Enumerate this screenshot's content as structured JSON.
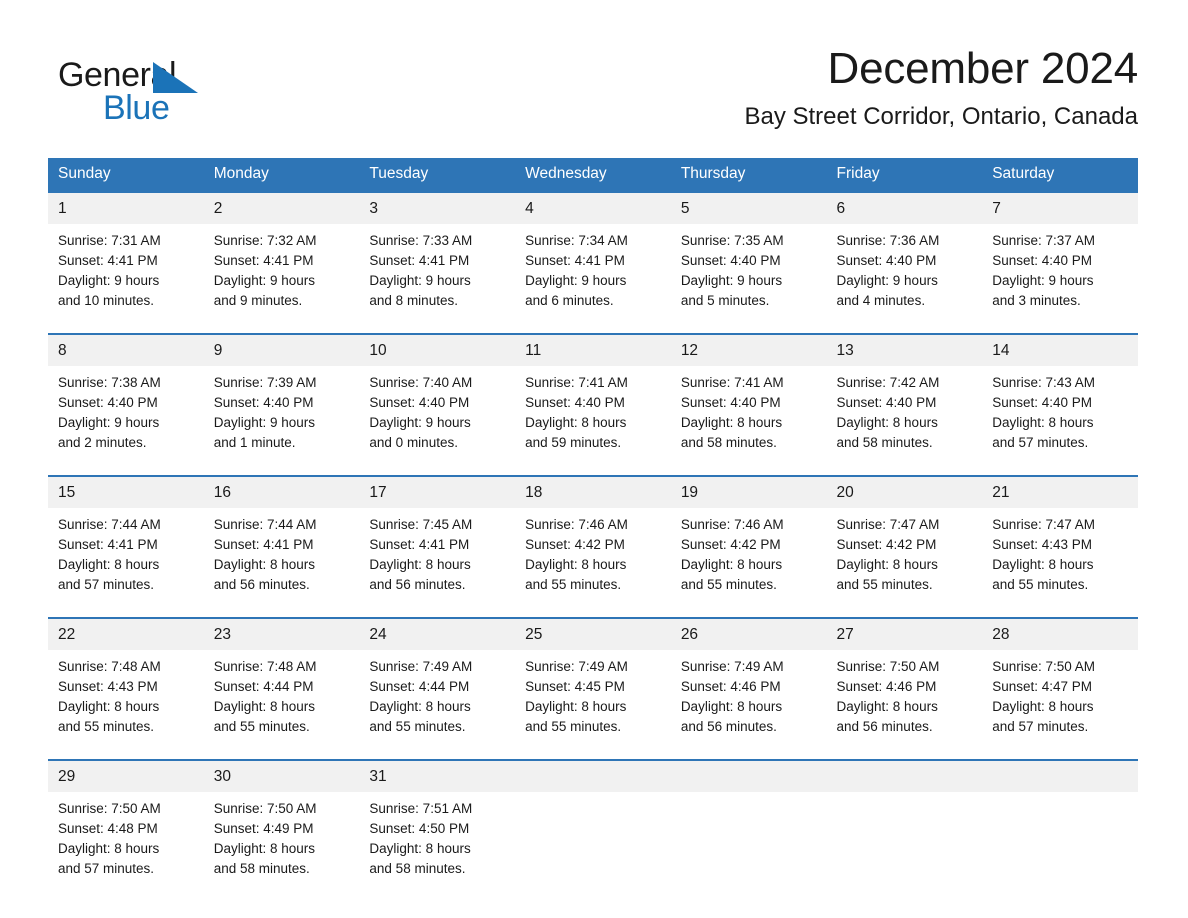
{
  "brand": {
    "name_top": "General",
    "name_bottom": "Blue",
    "accent_color": "#1b73b8",
    "triangle_icon": "triangle-icon"
  },
  "header": {
    "title": "December 2024",
    "location": "Bay Street Corridor, Ontario, Canada"
  },
  "calendar": {
    "header_bg": "#2E75B6",
    "daynum_bg": "#F1F1F1",
    "weekday_labels": [
      "Sunday",
      "Monday",
      "Tuesday",
      "Wednesday",
      "Thursday",
      "Friday",
      "Saturday"
    ],
    "weeks": [
      [
        {
          "day": "1",
          "sunrise": "Sunrise: 7:31 AM",
          "sunset": "Sunset: 4:41 PM",
          "daylight_1": "Daylight: 9 hours",
          "daylight_2": "and 10 minutes."
        },
        {
          "day": "2",
          "sunrise": "Sunrise: 7:32 AM",
          "sunset": "Sunset: 4:41 PM",
          "daylight_1": "Daylight: 9 hours",
          "daylight_2": "and 9 minutes."
        },
        {
          "day": "3",
          "sunrise": "Sunrise: 7:33 AM",
          "sunset": "Sunset: 4:41 PM",
          "daylight_1": "Daylight: 9 hours",
          "daylight_2": "and 8 minutes."
        },
        {
          "day": "4",
          "sunrise": "Sunrise: 7:34 AM",
          "sunset": "Sunset: 4:41 PM",
          "daylight_1": "Daylight: 9 hours",
          "daylight_2": "and 6 minutes."
        },
        {
          "day": "5",
          "sunrise": "Sunrise: 7:35 AM",
          "sunset": "Sunset: 4:40 PM",
          "daylight_1": "Daylight: 9 hours",
          "daylight_2": "and 5 minutes."
        },
        {
          "day": "6",
          "sunrise": "Sunrise: 7:36 AM",
          "sunset": "Sunset: 4:40 PM",
          "daylight_1": "Daylight: 9 hours",
          "daylight_2": "and 4 minutes."
        },
        {
          "day": "7",
          "sunrise": "Sunrise: 7:37 AM",
          "sunset": "Sunset: 4:40 PM",
          "daylight_1": "Daylight: 9 hours",
          "daylight_2": "and 3 minutes."
        }
      ],
      [
        {
          "day": "8",
          "sunrise": "Sunrise: 7:38 AM",
          "sunset": "Sunset: 4:40 PM",
          "daylight_1": "Daylight: 9 hours",
          "daylight_2": "and 2 minutes."
        },
        {
          "day": "9",
          "sunrise": "Sunrise: 7:39 AM",
          "sunset": "Sunset: 4:40 PM",
          "daylight_1": "Daylight: 9 hours",
          "daylight_2": "and 1 minute."
        },
        {
          "day": "10",
          "sunrise": "Sunrise: 7:40 AM",
          "sunset": "Sunset: 4:40 PM",
          "daylight_1": "Daylight: 9 hours",
          "daylight_2": "and 0 minutes."
        },
        {
          "day": "11",
          "sunrise": "Sunrise: 7:41 AM",
          "sunset": "Sunset: 4:40 PM",
          "daylight_1": "Daylight: 8 hours",
          "daylight_2": "and 59 minutes."
        },
        {
          "day": "12",
          "sunrise": "Sunrise: 7:41 AM",
          "sunset": "Sunset: 4:40 PM",
          "daylight_1": "Daylight: 8 hours",
          "daylight_2": "and 58 minutes."
        },
        {
          "day": "13",
          "sunrise": "Sunrise: 7:42 AM",
          "sunset": "Sunset: 4:40 PM",
          "daylight_1": "Daylight: 8 hours",
          "daylight_2": "and 58 minutes."
        },
        {
          "day": "14",
          "sunrise": "Sunrise: 7:43 AM",
          "sunset": "Sunset: 4:40 PM",
          "daylight_1": "Daylight: 8 hours",
          "daylight_2": "and 57 minutes."
        }
      ],
      [
        {
          "day": "15",
          "sunrise": "Sunrise: 7:44 AM",
          "sunset": "Sunset: 4:41 PM",
          "daylight_1": "Daylight: 8 hours",
          "daylight_2": "and 57 minutes."
        },
        {
          "day": "16",
          "sunrise": "Sunrise: 7:44 AM",
          "sunset": "Sunset: 4:41 PM",
          "daylight_1": "Daylight: 8 hours",
          "daylight_2": "and 56 minutes."
        },
        {
          "day": "17",
          "sunrise": "Sunrise: 7:45 AM",
          "sunset": "Sunset: 4:41 PM",
          "daylight_1": "Daylight: 8 hours",
          "daylight_2": "and 56 minutes."
        },
        {
          "day": "18",
          "sunrise": "Sunrise: 7:46 AM",
          "sunset": "Sunset: 4:42 PM",
          "daylight_1": "Daylight: 8 hours",
          "daylight_2": "and 55 minutes."
        },
        {
          "day": "19",
          "sunrise": "Sunrise: 7:46 AM",
          "sunset": "Sunset: 4:42 PM",
          "daylight_1": "Daylight: 8 hours",
          "daylight_2": "and 55 minutes."
        },
        {
          "day": "20",
          "sunrise": "Sunrise: 7:47 AM",
          "sunset": "Sunset: 4:42 PM",
          "daylight_1": "Daylight: 8 hours",
          "daylight_2": "and 55 minutes."
        },
        {
          "day": "21",
          "sunrise": "Sunrise: 7:47 AM",
          "sunset": "Sunset: 4:43 PM",
          "daylight_1": "Daylight: 8 hours",
          "daylight_2": "and 55 minutes."
        }
      ],
      [
        {
          "day": "22",
          "sunrise": "Sunrise: 7:48 AM",
          "sunset": "Sunset: 4:43 PM",
          "daylight_1": "Daylight: 8 hours",
          "daylight_2": "and 55 minutes."
        },
        {
          "day": "23",
          "sunrise": "Sunrise: 7:48 AM",
          "sunset": "Sunset: 4:44 PM",
          "daylight_1": "Daylight: 8 hours",
          "daylight_2": "and 55 minutes."
        },
        {
          "day": "24",
          "sunrise": "Sunrise: 7:49 AM",
          "sunset": "Sunset: 4:44 PM",
          "daylight_1": "Daylight: 8 hours",
          "daylight_2": "and 55 minutes."
        },
        {
          "day": "25",
          "sunrise": "Sunrise: 7:49 AM",
          "sunset": "Sunset: 4:45 PM",
          "daylight_1": "Daylight: 8 hours",
          "daylight_2": "and 55 minutes."
        },
        {
          "day": "26",
          "sunrise": "Sunrise: 7:49 AM",
          "sunset": "Sunset: 4:46 PM",
          "daylight_1": "Daylight: 8 hours",
          "daylight_2": "and 56 minutes."
        },
        {
          "day": "27",
          "sunrise": "Sunrise: 7:50 AM",
          "sunset": "Sunset: 4:46 PM",
          "daylight_1": "Daylight: 8 hours",
          "daylight_2": "and 56 minutes."
        },
        {
          "day": "28",
          "sunrise": "Sunrise: 7:50 AM",
          "sunset": "Sunset: 4:47 PM",
          "daylight_1": "Daylight: 8 hours",
          "daylight_2": "and 57 minutes."
        }
      ],
      [
        {
          "day": "29",
          "sunrise": "Sunrise: 7:50 AM",
          "sunset": "Sunset: 4:48 PM",
          "daylight_1": "Daylight: 8 hours",
          "daylight_2": "and 57 minutes."
        },
        {
          "day": "30",
          "sunrise": "Sunrise: 7:50 AM",
          "sunset": "Sunset: 4:49 PM",
          "daylight_1": "Daylight: 8 hours",
          "daylight_2": "and 58 minutes."
        },
        {
          "day": "31",
          "sunrise": "Sunrise: 7:51 AM",
          "sunset": "Sunset: 4:50 PM",
          "daylight_1": "Daylight: 8 hours",
          "daylight_2": "and 58 minutes."
        },
        {
          "day": "",
          "sunrise": "",
          "sunset": "",
          "daylight_1": "",
          "daylight_2": ""
        },
        {
          "day": "",
          "sunrise": "",
          "sunset": "",
          "daylight_1": "",
          "daylight_2": ""
        },
        {
          "day": "",
          "sunrise": "",
          "sunset": "",
          "daylight_1": "",
          "daylight_2": ""
        },
        {
          "day": "",
          "sunrise": "",
          "sunset": "",
          "daylight_1": "",
          "daylight_2": ""
        }
      ]
    ]
  }
}
